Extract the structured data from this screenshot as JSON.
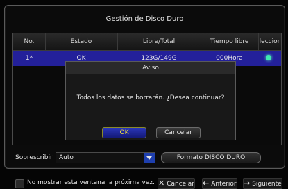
{
  "window": {
    "title": "Gestión de Disco Duro"
  },
  "table": {
    "headers": [
      "No.",
      "Estado",
      "Libre/Total",
      "Tiempo libre",
      "Seleccionar"
    ],
    "header_visible": [
      "No.",
      "Estado",
      "Libre/Total",
      "Tiempo libre",
      "leccior"
    ],
    "rows": [
      {
        "no": "1*",
        "estado": "OK",
        "libre_total": "123G/149G",
        "tiempo": "000Hora",
        "selected": true
      }
    ],
    "row_visible": {
      "estado": "OK",
      "libre_total": "123G/149G",
      "tiempo": "000Hora"
    }
  },
  "dialog": {
    "title": "Aviso",
    "message": "Todos los datos se borrarán. ¿Desea continuar?",
    "ok_label": "OK",
    "cancel_label": "Cancelar"
  },
  "overwrite": {
    "label": "Sobrescribir",
    "value": "Auto"
  },
  "format_button": "Formato DISCO DURO",
  "footer": {
    "checkbox_label": "No mostrar esta ventana la próxima vez.",
    "cancel_label": "Cancelar",
    "prev_label": "Anterior",
    "next_label": "Siguiente"
  },
  "colors": {
    "selected_row": "#23209a",
    "select_indicator": "#3fe8b0",
    "ok_text": "#f3e23a",
    "arrow_bg": "#1e3fae"
  },
  "icons": {
    "cancel": "close-icon",
    "prev": "arrow-left-icon",
    "next": "arrow-right-icon"
  }
}
